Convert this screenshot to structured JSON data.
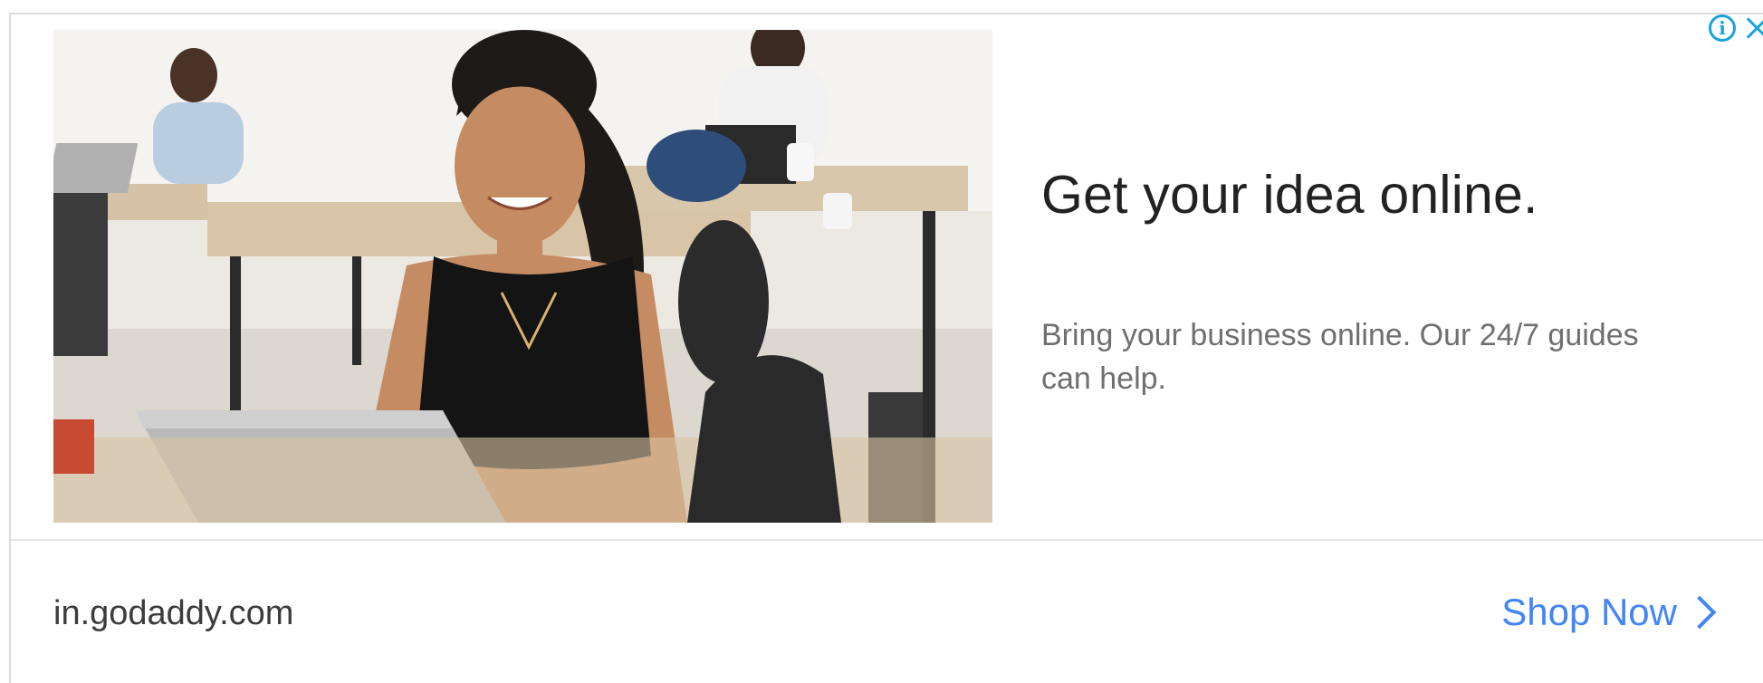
{
  "ad": {
    "headline": "Get your idea online.",
    "body": "Bring your business online. Our 24/7 guides can help.",
    "domain": "in.godaddy.com",
    "cta_label": "Shop Now",
    "icons": {
      "info": "info-icon",
      "close": "close-icon",
      "cta": "chevron-right-icon"
    },
    "colors": {
      "accent": "#4285f4",
      "adchoices": "#1aa3d9",
      "headline": "#222222",
      "body": "#6f6f6f"
    }
  }
}
